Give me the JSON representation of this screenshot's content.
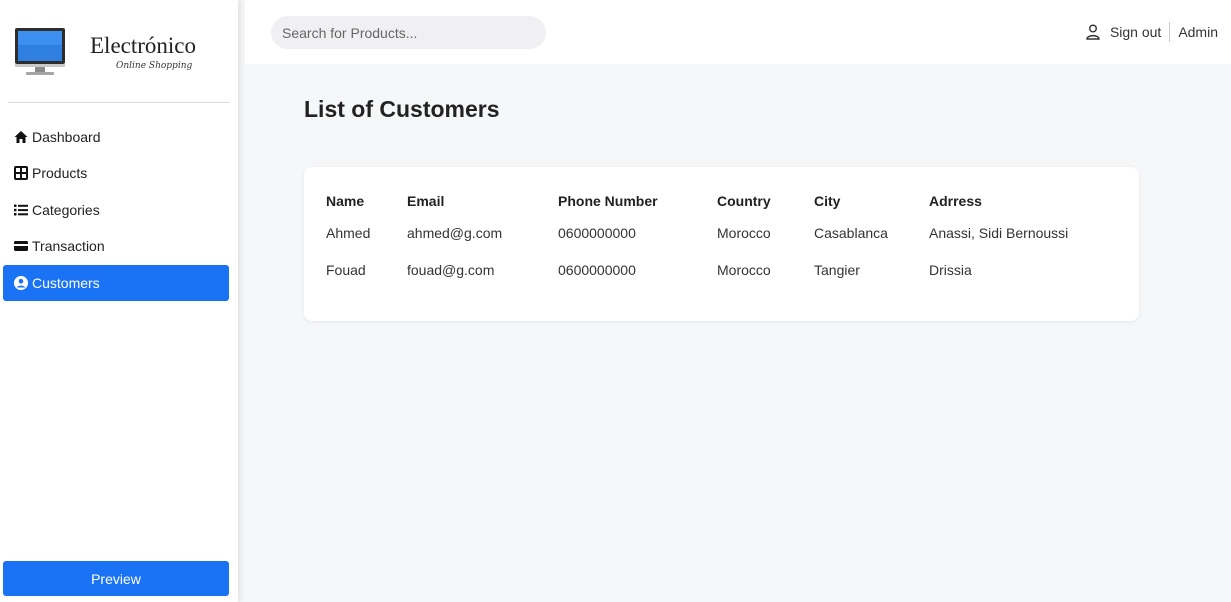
{
  "brand": {
    "name": "Electrónico",
    "tagline": "Online Shopping"
  },
  "sidebar": {
    "items": [
      {
        "label": "Dashboard",
        "icon": "home-icon"
      },
      {
        "label": "Products",
        "icon": "grid-icon"
      },
      {
        "label": "Categories",
        "icon": "list-icon"
      },
      {
        "label": "Transaction",
        "icon": "credit-card-icon"
      },
      {
        "label": "Customers",
        "icon": "user-circle-icon",
        "active": true
      }
    ],
    "preview_label": "Preview"
  },
  "topbar": {
    "search_placeholder": "Search for Products...",
    "signout_label": "Sign out",
    "user_label": "Admin"
  },
  "main": {
    "title": "List of Customers",
    "table": {
      "columns": [
        "Name",
        "Email",
        "Phone Number",
        "Country",
        "City",
        "Adrress"
      ],
      "rows": [
        [
          "Ahmed",
          "ahmed@g.com",
          "0600000000",
          "Morocco",
          "Casablanca",
          "Anassi, Sidi Bernoussi"
        ],
        [
          "Fouad",
          "fouad@g.com",
          "0600000000",
          "Morocco",
          "Tangier",
          "Drissia"
        ]
      ]
    }
  },
  "colors": {
    "accent": "#1a73f5",
    "background": "#f6f7f9",
    "surface": "#ffffff"
  }
}
